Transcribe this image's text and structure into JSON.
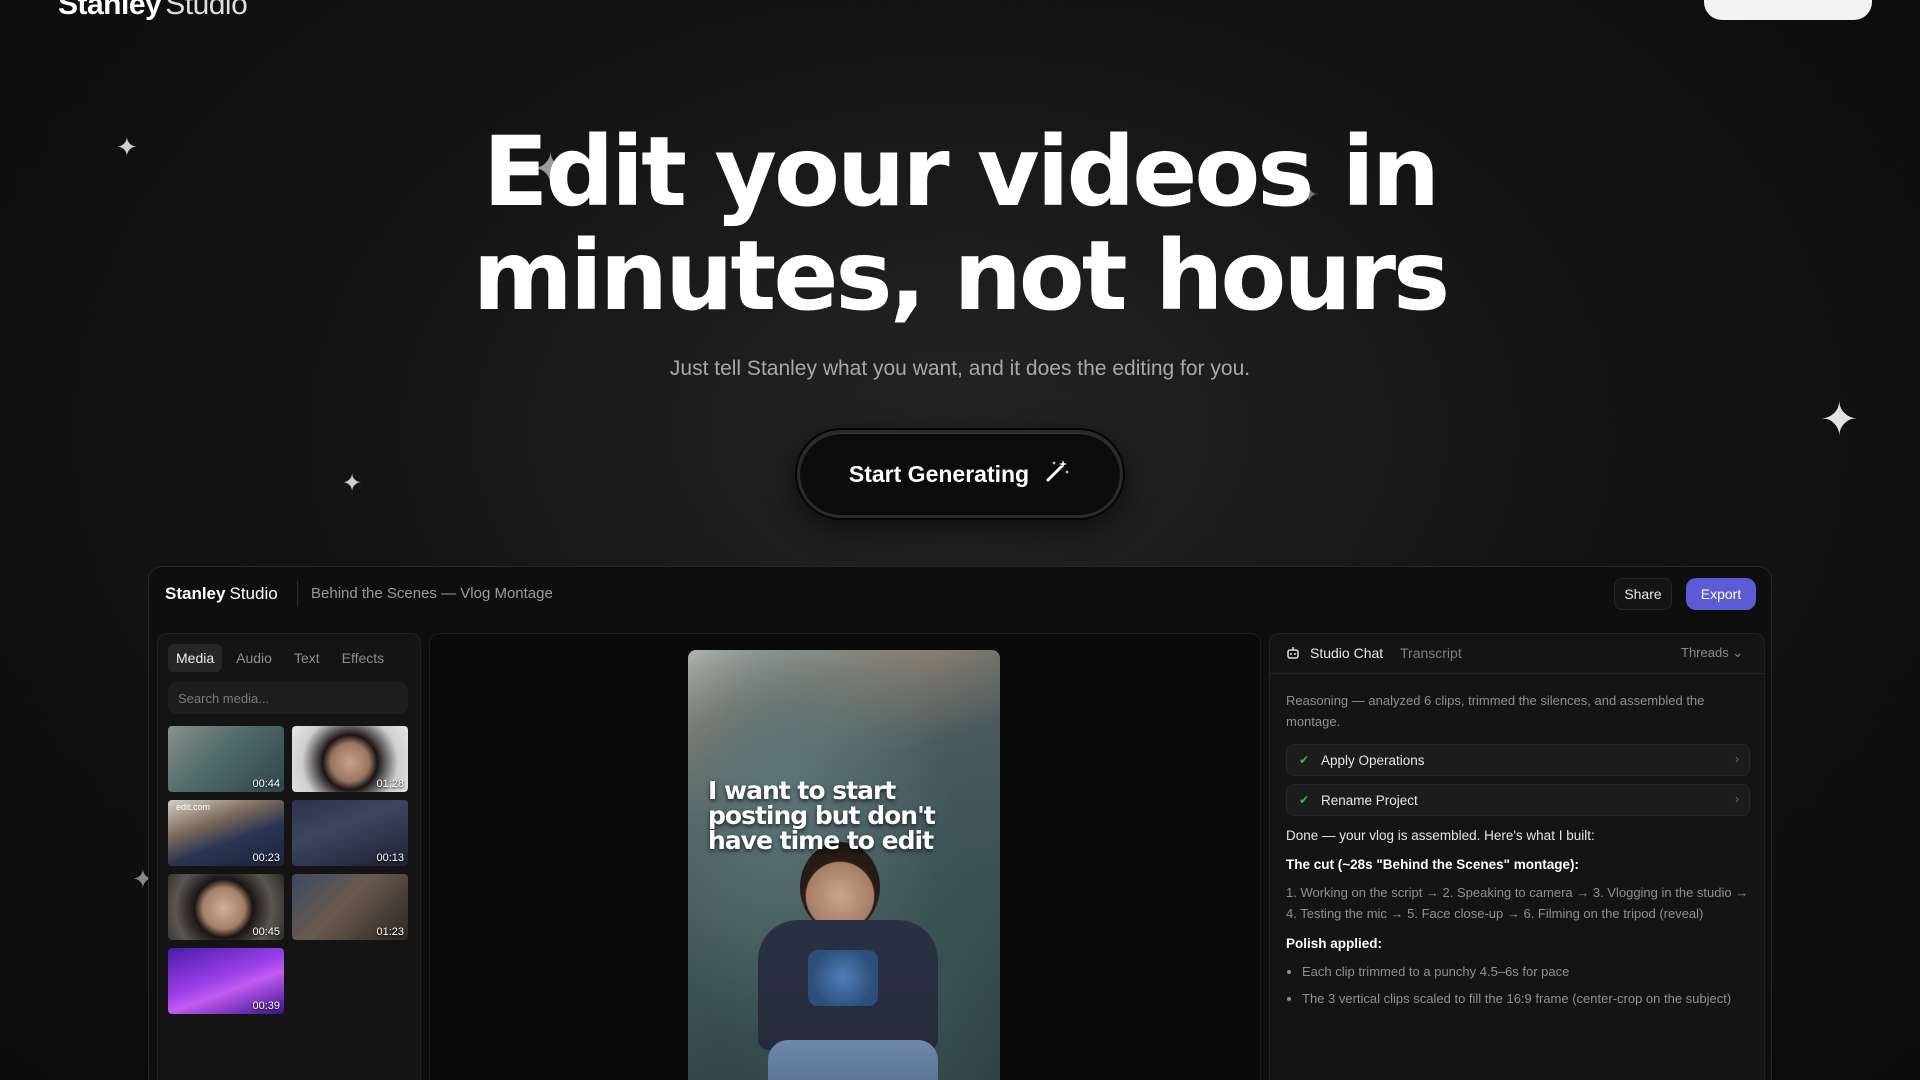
{
  "brand": {
    "name_bold": "Stanley",
    "name_thin": "Studio"
  },
  "hero": {
    "title_line1": "Edit your videos in",
    "title_line2": "minutes, not hours",
    "subtitle": "Just tell Stanley what you want, and it does the editing for you.",
    "cta_label": "Start Generating",
    "cta_icon": "magic-wand-icon"
  },
  "app": {
    "logo_bold": "Stanley",
    "logo_thin": "Studio",
    "project_title": "Behind the Scenes — Vlog Montage",
    "share_label": "Share",
    "export_label": "Export",
    "accent_color": "#5b5bd6",
    "media_panel": {
      "tabs": [
        "Media",
        "Audio",
        "Text",
        "Effects"
      ],
      "active_tab": "Media",
      "search_placeholder": "Search media...",
      "clips": [
        {
          "duration": "00:44",
          "tag": ""
        },
        {
          "duration": "01:28",
          "tag": ""
        },
        {
          "duration": "00:23",
          "tag": "edit.com"
        },
        {
          "duration": "00:13",
          "tag": ""
        },
        {
          "duration": "00:45",
          "tag": ""
        },
        {
          "duration": "01:23",
          "tag": ""
        },
        {
          "duration": "00:39",
          "tag": ""
        }
      ]
    },
    "preview": {
      "caption": "I want to start posting but don't have time to edit"
    },
    "chat": {
      "active_tab": "Studio Chat",
      "inactive_tab": "Transcript",
      "threads_label": "Threads ⌄",
      "reasoning": "Reasoning — analyzed 6 clips, trimmed the silences, and assembled the montage.",
      "operations": [
        "Apply Operations",
        "Rename Project"
      ],
      "done_text": "Done — your vlog is assembled. Here's what I built:",
      "cut_title": "The cut (~28s \"Behind the Scenes\" montage):",
      "cut_body": "1. Working on the script → 2. Speaking to camera → 3. Vlogging in the studio → 4. Testing the mic → 5. Face close-up → 6. Filming on the tripod (reveal)",
      "polish_title": "Polish applied:",
      "polish_items": [
        "Each clip trimmed to a punchy 4.5–6s for pace",
        "The 3 vertical clips scaled to fill the 16:9 frame (center-crop on the subject)"
      ]
    }
  }
}
